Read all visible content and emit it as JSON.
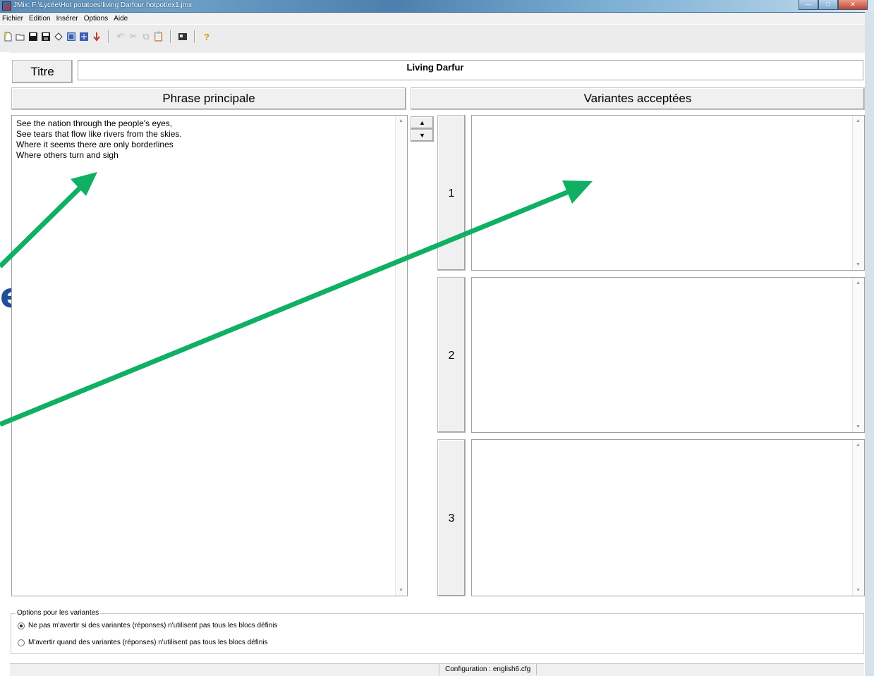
{
  "window": {
    "title": "JMix: F:\\Lycée\\Hot potatoes\\living Darfour hotpot\\ex1.jmx",
    "controls": [
      "—",
      "□",
      "✕"
    ]
  },
  "menu": [
    "Fichier",
    "Edition",
    "Insérer",
    "Options",
    "Aide"
  ],
  "toolbar": {
    "icons": [
      "new-file-icon",
      "open-folder-icon",
      "save-icon",
      "save-as-icon",
      "erase-icon",
      "export-web-icon",
      "export-web2-icon",
      "insert-arrow-icon",
      "undo-icon",
      "cut-icon",
      "copy-icon",
      "paste-icon",
      "config-icon",
      "help-icon"
    ],
    "help_glyph": "?"
  },
  "title_section": {
    "button_label": "Titre",
    "value": "Living Darfur"
  },
  "main": {
    "header": "Phrase principale",
    "lines": [
      "See the nation through the people's eyes,",
      "See tears that flow like rivers from the skies.",
      "Where it seems there are only borderlines",
      "Where others turn and sigh"
    ]
  },
  "variants": {
    "header": "Variantes acceptées",
    "items": [
      {
        "number": "1",
        "value": ""
      },
      {
        "number": "2",
        "value": ""
      },
      {
        "number": "3",
        "value": ""
      }
    ]
  },
  "options": {
    "legend": "Options pour les variantes",
    "choices": [
      {
        "label": "Ne pas m'avertir si des variantes (réponses) n'utilisent pas tous les blocs définis",
        "selected": true
      },
      {
        "label": "M'avertir quand des variantes (réponses) n'utilisent pas tous les blocs définis",
        "selected": false
      }
    ]
  },
  "statusbar": {
    "config": "Configuration : english6.cfg"
  },
  "overlay": {
    "arrow_color": "#10b064",
    "partial_glyph": "e"
  }
}
